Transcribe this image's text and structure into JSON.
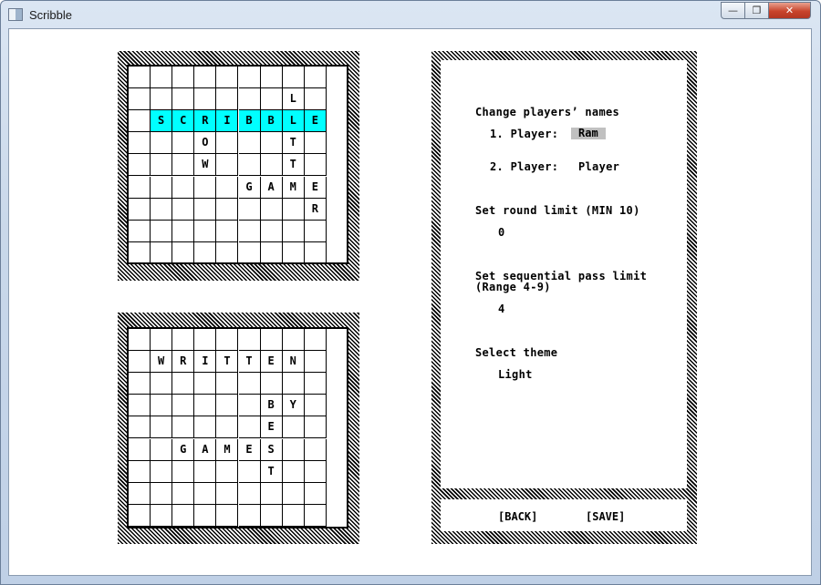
{
  "window": {
    "title": "Scribble",
    "minimize_glyph": "—",
    "maximize_glyph": "❐",
    "close_glyph": "✕"
  },
  "board1": {
    "rows": [
      [
        "",
        "",
        "",
        "",
        "",
        "",
        "",
        "",
        ""
      ],
      [
        "",
        "",
        "",
        "",
        "",
        "",
        "",
        "L",
        ""
      ],
      [
        "",
        "S",
        "C",
        "R",
        "I",
        "B",
        "B",
        "L",
        "E"
      ],
      [
        "",
        "",
        "",
        "O",
        "",
        "",
        "",
        "T",
        ""
      ],
      [
        "",
        "",
        "",
        "W",
        "",
        "",
        "",
        "T",
        ""
      ],
      [
        "",
        "",
        "",
        "",
        "",
        "G",
        "A",
        "M",
        "E"
      ],
      [
        "",
        "",
        "",
        "",
        "",
        "",
        "",
        "",
        "R"
      ],
      [
        "",
        "",
        "",
        "",
        "",
        "",
        "",
        "",
        ""
      ],
      [
        "",
        "",
        "",
        "",
        "",
        "",
        "",
        "",
        ""
      ]
    ],
    "highlight_row": 2,
    "highlight_cols": [
      1,
      2,
      3,
      4,
      5,
      6,
      7,
      8
    ],
    "highlight_color": "#00ffff"
  },
  "board2": {
    "rows": [
      [
        "",
        "",
        "",
        "",
        "",
        "",
        "",
        "",
        ""
      ],
      [
        "",
        "W",
        "R",
        "I",
        "T",
        "T",
        "E",
        "N",
        ""
      ],
      [
        "",
        "",
        "",
        "",
        "",
        "",
        "",
        "",
        ""
      ],
      [
        "",
        "",
        "",
        "",
        "",
        "",
        "B",
        "Y",
        ""
      ],
      [
        "",
        "",
        "",
        "",
        "",
        "",
        "E",
        "",
        ""
      ],
      [
        "",
        "",
        "G",
        "A",
        "M",
        "E",
        "S",
        "",
        ""
      ],
      [
        "",
        "",
        "",
        "",
        "",
        "",
        "T",
        "",
        ""
      ],
      [
        "",
        "",
        "",
        "",
        "",
        "",
        "",
        "",
        ""
      ],
      [
        "",
        "",
        "",
        "",
        "",
        "",
        "",
        "",
        ""
      ]
    ]
  },
  "settings": {
    "change_names_heading": "Change players’ names",
    "player1_label": "1. Player:",
    "player1_value": "Ram",
    "player2_label": "2. Player:",
    "player2_value": "Player",
    "round_limit_label": "Set round limit (MIN 10)",
    "round_limit_value": "0",
    "pass_limit_label_line1": "Set sequential pass limit",
    "pass_limit_label_line2": "(Range 4-9)",
    "pass_limit_value": "4",
    "theme_label": "Select theme",
    "theme_value": "Light",
    "back_button": "[BACK]",
    "save_button": "[SAVE]"
  },
  "colors": {
    "highlight": "#00ffff",
    "selected_field": "#c0c0c0"
  }
}
